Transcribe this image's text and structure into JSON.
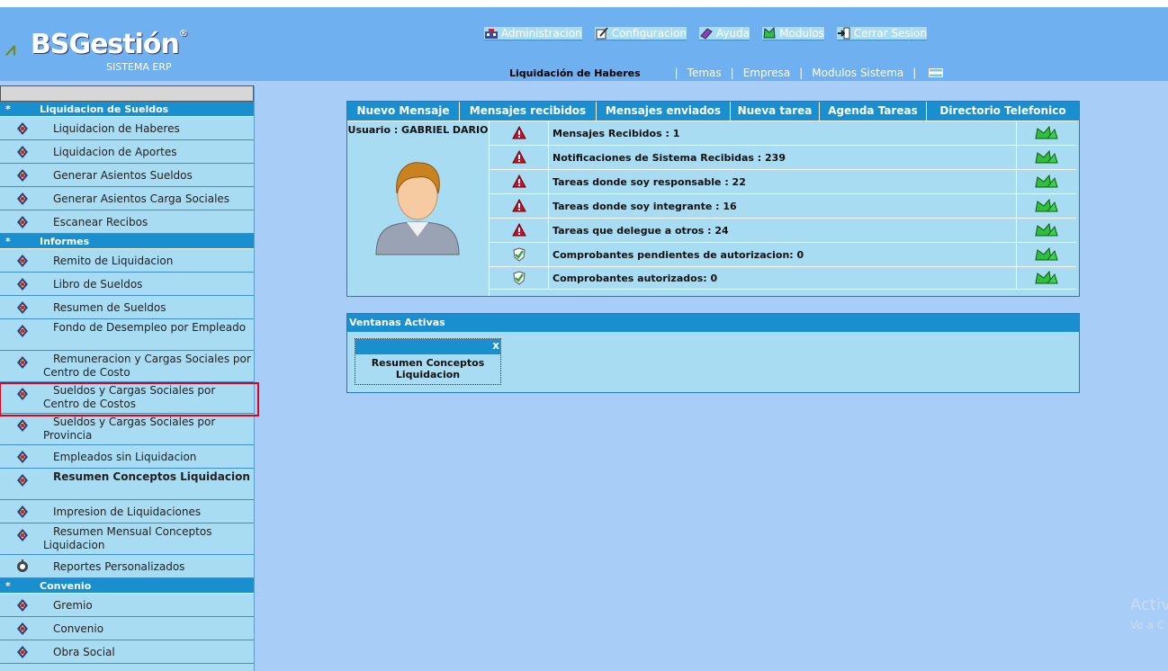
{
  "brand": {
    "name": "BSGestión",
    "subtitle": "SISTEMA ERP"
  },
  "topnav": [
    {
      "label": "Administracion",
      "icon": "admin-icon"
    },
    {
      "label": "Configuracion",
      "icon": "config-icon"
    },
    {
      "label": "Ayuda",
      "icon": "help-icon"
    },
    {
      "label": "Modulos",
      "icon": "modules-icon"
    },
    {
      "label": "Cerrar Sesion",
      "icon": "logout-icon"
    }
  ],
  "subnav": {
    "current": "Liquidación de Haberes",
    "links": [
      "Temas",
      "Empresa",
      "Modulos Sistema"
    ]
  },
  "sidebar": {
    "sections": [
      {
        "title": "Liquidacion de Sueldos",
        "items": [
          "Liquidacion de Haberes",
          "Liquidacion de Aportes",
          "Generar Asientos Sueldos",
          "Generar Asientos Carga Sociales",
          "Escanear Recibos"
        ]
      },
      {
        "title": "Informes",
        "items": [
          "Remito de Liquidacion",
          "Libro de Sueldos",
          "Resumen de Sueldos",
          "Fondo de Desempleo por Empleado",
          "Remuneracion y Cargas Sociales por Centro de Costo",
          "Sueldos y Cargas Sociales por Centro de Costos",
          "Sueldos y Cargas Sociales por Provincia",
          "Empleados sin Liquidacion",
          "Resumen Conceptos Liquidacion",
          "Impresion de Liquidaciones",
          "Resumen Mensual Conceptos Liquidacion",
          "Reportes Personalizados"
        ]
      },
      {
        "title": "Convenio",
        "items": [
          "Gremio",
          "Convenio",
          "Obra Social"
        ]
      }
    ],
    "section_marker": "*"
  },
  "tabs": [
    "Nuevo Mensaje",
    "Mensajes recibidos",
    "Mensajes enviados",
    "Nueva tarea",
    "Agenda Tareas",
    "Directorio Telefonico"
  ],
  "user": {
    "label": "Usuario : GABRIEL DARIO"
  },
  "messages": [
    {
      "text": "Mensajes Recibidos : 1",
      "status": "warning"
    },
    {
      "text": "Notificaciones de Sistema Recibidas : 239",
      "status": "warning"
    },
    {
      "text": "Tareas donde soy responsable : 22",
      "status": "warning"
    },
    {
      "text": "Tareas donde soy integrante : 16",
      "status": "warning"
    },
    {
      "text": "Tareas que delegue a otros : 24",
      "status": "warning"
    },
    {
      "text": "Comprobantes pendientes de autorizacion: 0",
      "status": "ok"
    },
    {
      "text": "Comprobantes autorizados: 0",
      "status": "ok"
    }
  ],
  "ventanas": {
    "title": "Ventanas Activas",
    "close": "x",
    "windows": [
      "Resumen Conceptos Liquidacion"
    ]
  },
  "watermark": {
    "line1": "Activ",
    "line2": "Ve a C"
  },
  "colors": {
    "header": "#6fb0f0",
    "section": "#1a8fd0",
    "panel": "#a8dcf3",
    "background": "#a8cdf7",
    "selection": "#e0001a"
  }
}
